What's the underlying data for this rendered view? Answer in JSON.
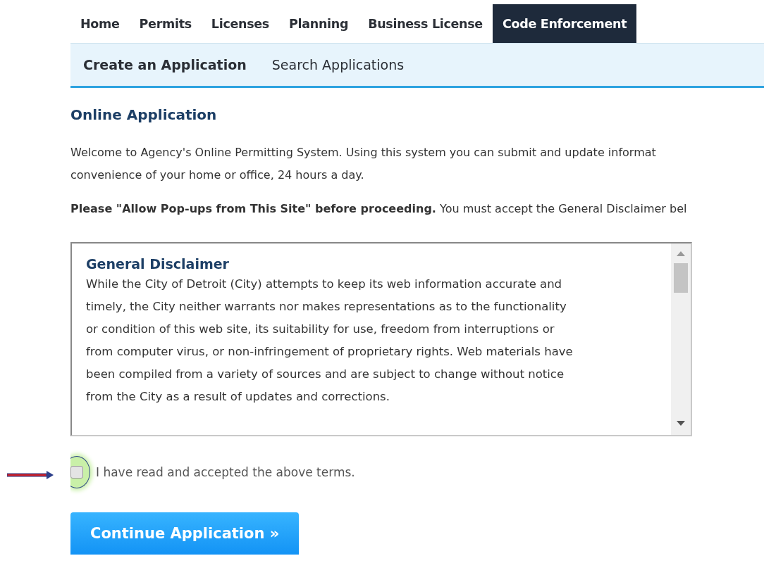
{
  "nav_tabs": [
    {
      "label": "Home",
      "selected": false
    },
    {
      "label": "Permits",
      "selected": false
    },
    {
      "label": "Licenses",
      "selected": false
    },
    {
      "label": "Planning",
      "selected": false
    },
    {
      "label": "Business License",
      "selected": false
    },
    {
      "label": "Code Enforcement",
      "selected": true
    }
  ],
  "sub_nav": [
    {
      "label": "Create an Application",
      "selected": true
    },
    {
      "label": "Search Applications",
      "selected": false
    }
  ],
  "heading": "Online Application",
  "intro_lines": [
    "Welcome to Agency's Online Permitting System. Using this system you can submit and update informat",
    "convenience of your home or office, 24 hours a day."
  ],
  "notice": "**Please \"Allow Pop-ups from This Site\" before proceeding.** You must accept the General Disclaimer bel",
  "disclaimer": {
    "title": "General Disclaimer",
    "lines": [
      "While the City of Detroit (City) attempts to keep its web information accurate and",
      "timely, the City neither warrants nor makes representations as to the functionality",
      "or condition of this web site, its suitability for use, freedom from interruptions or",
      "from computer virus, or non-infringement of proprietary rights. Web materials have",
      "been compiled from a variety of sources and are subject to change without notice",
      "from the City as a result of updates and corrections."
    ]
  },
  "accept": {
    "label": "I have read and accepted the above terms.",
    "checked": false,
    "highlighted": true
  },
  "continue_button": "Continue Application »"
}
